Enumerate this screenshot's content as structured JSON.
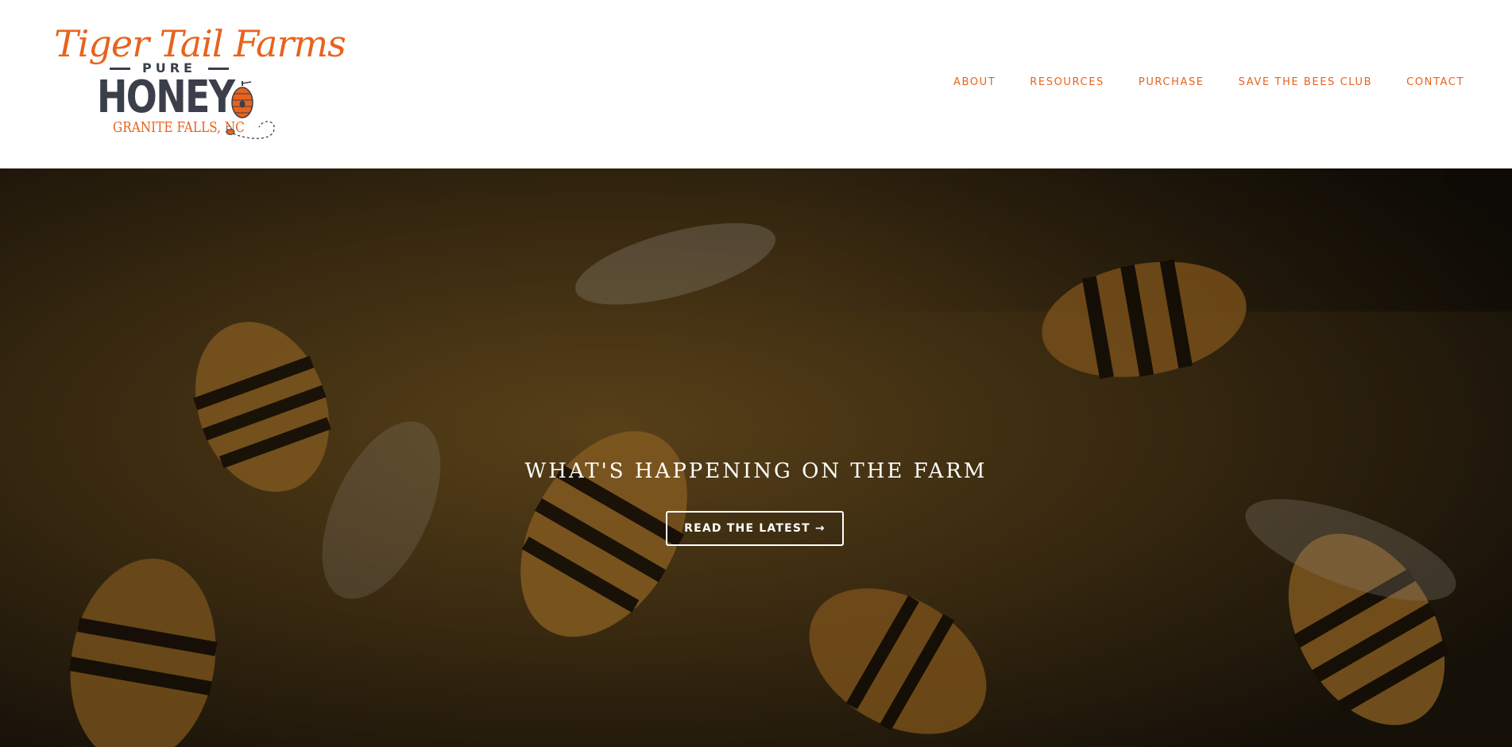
{
  "brand": {
    "logo_top": "Tiger Tail Farms",
    "logo_pure": "PURE",
    "logo_honey": "HONEY",
    "logo_location": "GRANITE FALLS, NC"
  },
  "nav": {
    "items": [
      {
        "label": "ABOUT"
      },
      {
        "label": "RESOURCES"
      },
      {
        "label": "PURCHASE"
      },
      {
        "label": "SAVE THE BEES CLUB"
      },
      {
        "label": "CONTACT"
      }
    ]
  },
  "hero": {
    "title": "WHAT'S HAPPENING ON THE FARM",
    "button_label": "READ THE LATEST",
    "button_arrow": "→"
  },
  "colors": {
    "accent": "#e8631e",
    "logo_dark": "#3a3f4a",
    "hero_text": "#ffffff"
  }
}
